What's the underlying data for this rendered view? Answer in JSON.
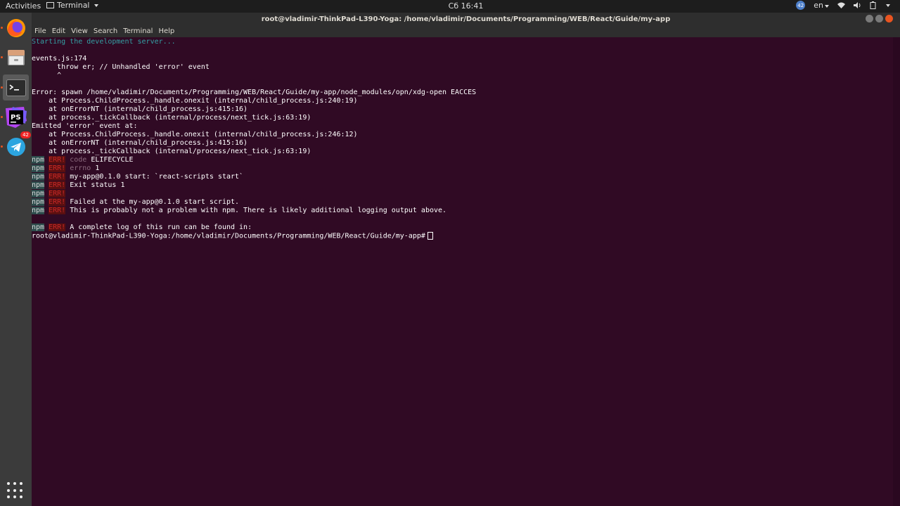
{
  "topbar": {
    "activities": "Activities",
    "app_name": "Terminal",
    "clock": "Сб 16:41",
    "badge": "42",
    "language": "en"
  },
  "dock": {
    "items": [
      {
        "name": "firefox-icon"
      },
      {
        "name": "files-icon"
      },
      {
        "name": "terminal-icon"
      },
      {
        "name": "phpstorm-icon",
        "label": "PS"
      },
      {
        "name": "telegram-icon",
        "badge": "42"
      }
    ]
  },
  "window": {
    "title": "root@vladimir-ThinkPad-L390-Yoga: /home/vladimir/Documents/Programming/WEB/React/Guide/my-app",
    "menu": [
      "File",
      "Edit",
      "View",
      "Search",
      "Terminal",
      "Help"
    ]
  },
  "terminal": {
    "l0": "Starting the development server...",
    "l1": "",
    "l2": "events.js:174",
    "l3": "      throw er; // Unhandled 'error' event",
    "l4": "      ^",
    "l5": "",
    "l6": "Error: spawn /home/vladimir/Documents/Programming/WEB/React/Guide/my-app/node_modules/opn/xdg-open EACCES",
    "l7": "    at Process.ChildProcess._handle.onexit (internal/child_process.js:240:19)",
    "l8": "    at onErrorNT (internal/child_process.js:415:16)",
    "l9": "    at process._tickCallback (internal/process/next_tick.js:63:19)",
    "l10": "Emitted 'error' event at:",
    "l11": "    at Process.ChildProcess._handle.onexit (internal/child_process.js:246:12)",
    "l12": "    at onErrorNT (internal/child_process.js:415:16)",
    "l13": "    at process._tickCallback (internal/process/next_tick.js:63:19)",
    "npm": "npm",
    "err": "ERR!",
    "e1_key": "code",
    "e1_val": "ELIFECYCLE",
    "e2_key": "errno",
    "e2_val": "1",
    "e3": "my-app@0.1.0 start: `react-scripts start`",
    "e4": "Exit status 1",
    "e6": "Failed at the my-app@0.1.0 start script.",
    "e7": "This is probably not a problem with npm. There is likely additional logging output above.",
    "e9": "A complete log of this run can be found in:",
    "prompt": "root@vladimir-ThinkPad-L390-Yoga:/home/vladimir/Documents/Programming/WEB/React/Guide/my-app#"
  }
}
